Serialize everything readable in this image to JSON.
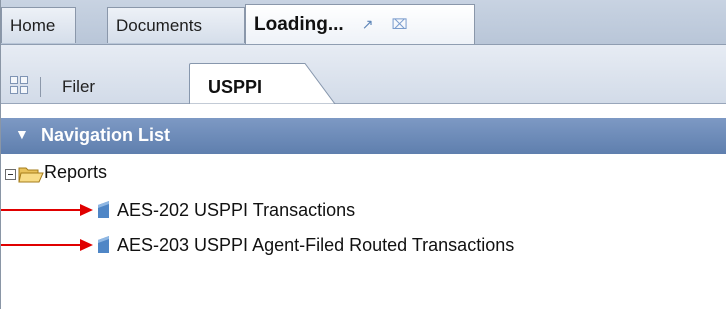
{
  "top_tabs": {
    "home": "Home",
    "documents": "Documents",
    "loading": "Loading..."
  },
  "sub_tabs": {
    "filer": "Filer",
    "usppi": "USPPI"
  },
  "navigation": {
    "title": "Navigation List"
  },
  "tree": {
    "folder": "Reports",
    "items": [
      {
        "label": "AES-202 USPPI Transactions"
      },
      {
        "label": "AES-203 USPPI Agent-Filed Routed Transactions"
      }
    ]
  },
  "colors": {
    "arrow": "#e00000",
    "header_bg": "#6b88b8",
    "document_icon": "#4f86c6"
  },
  "icons": [
    "grid-icon",
    "restore-icon",
    "close-icon",
    "collapse-triangle-icon",
    "collapse-icon",
    "folder-open-icon",
    "document-icon",
    "arrow-icon"
  ]
}
